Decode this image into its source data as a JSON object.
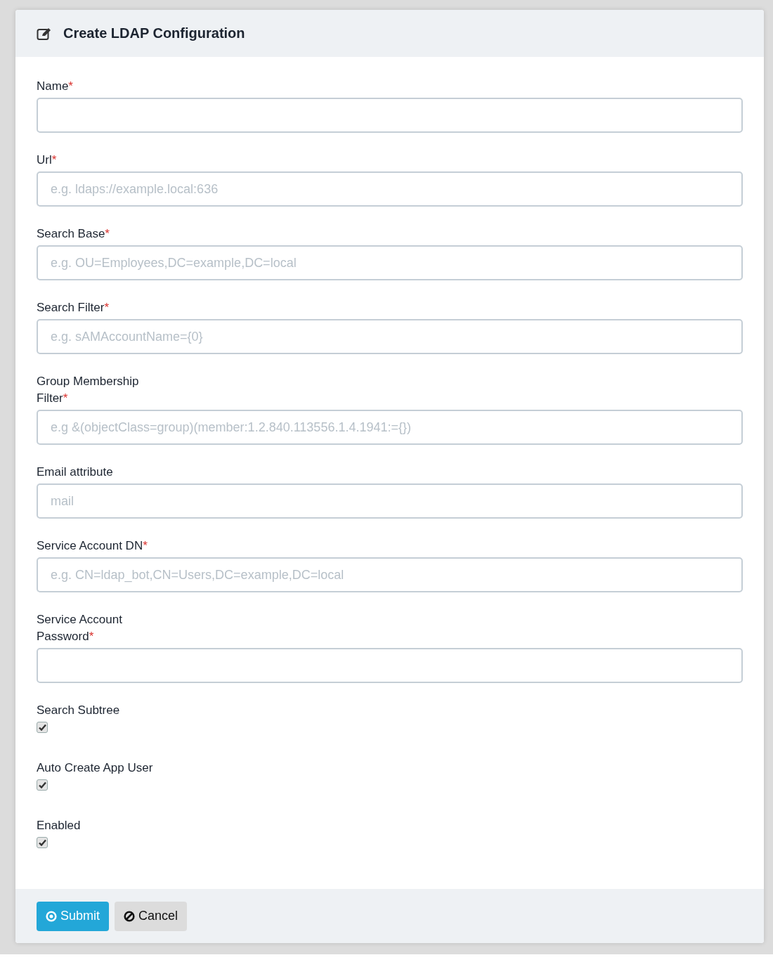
{
  "card": {
    "title": "Create LDAP Configuration"
  },
  "fields": [
    {
      "kind": "text",
      "label": "Name",
      "required_mark": "*"
    },
    {
      "kind": "text",
      "label": "Url",
      "required_mark": "*",
      "placeholder": "e.g. ldaps://example.local:636"
    },
    {
      "kind": "text",
      "label": "Search Base",
      "required_mark": "*",
      "placeholder": "e.g. OU=Employees,DC=example,DC=local"
    },
    {
      "kind": "text",
      "label": "Search Filter",
      "required_mark": "*",
      "placeholder": "e.g. sAMAccountName={0}"
    },
    {
      "kind": "text",
      "label": "Group Membership Filter",
      "required_mark": "*",
      "placeholder": "e.g &(objectClass=group)(member:1.2.840.113556.1.4.1941:={})"
    },
    {
      "kind": "text",
      "label": "Email attribute",
      "placeholder": "mail"
    },
    {
      "kind": "text",
      "label": "Service Account DN",
      "required_mark": "*",
      "placeholder": "e.g. CN=ldap_bot,CN=Users,DC=example,DC=local"
    },
    {
      "kind": "password",
      "label": "Service Account Password",
      "required_mark": "*"
    },
    {
      "kind": "checkbox",
      "label": "Search Subtree",
      "checked": true
    },
    {
      "kind": "checkbox",
      "label": "Auto Create App User",
      "checked": true
    },
    {
      "kind": "checkbox",
      "label": "Enabled",
      "checked": true
    }
  ],
  "buttons": [
    {
      "kind": "submit",
      "label": "Submit"
    },
    {
      "kind": "cancel",
      "label": "Cancel"
    }
  ]
}
